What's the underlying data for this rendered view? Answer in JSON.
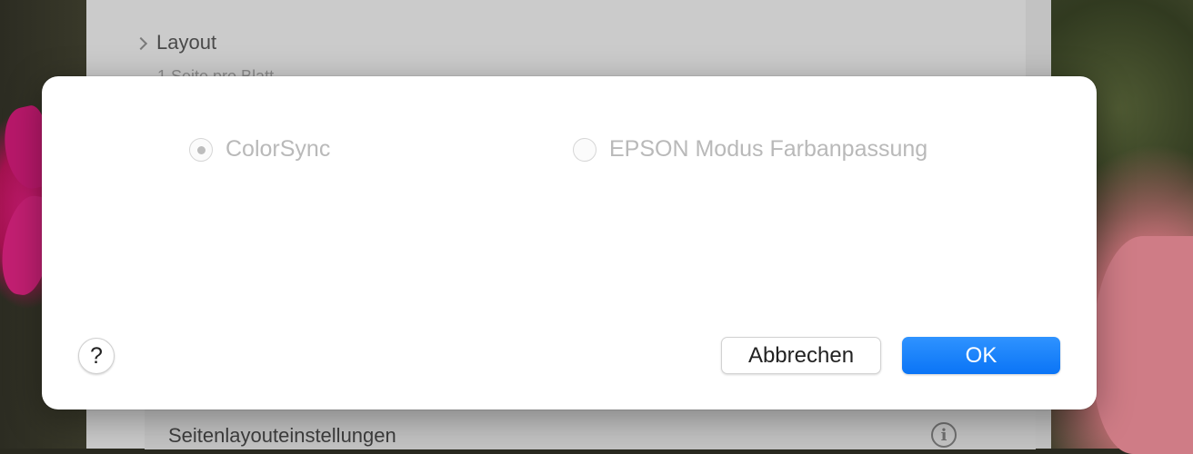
{
  "background_sheet": {
    "section_label": "Layout",
    "section_summary": "1 Seite pro Blatt",
    "page_layout_label": "Seitenlayouteinstellungen",
    "info_icon": "info-icon"
  },
  "dialog": {
    "options": [
      {
        "label": "ColorSync",
        "selected": true,
        "enabled": false
      },
      {
        "label": "EPSON Modus Farbanpassung",
        "selected": false,
        "enabled": false
      }
    ],
    "help_label": "?",
    "cancel_label": "Abbrechen",
    "ok_label": "OK"
  },
  "colors": {
    "accent": "#0a7aff",
    "disabled_text": "#b9b9b9"
  }
}
